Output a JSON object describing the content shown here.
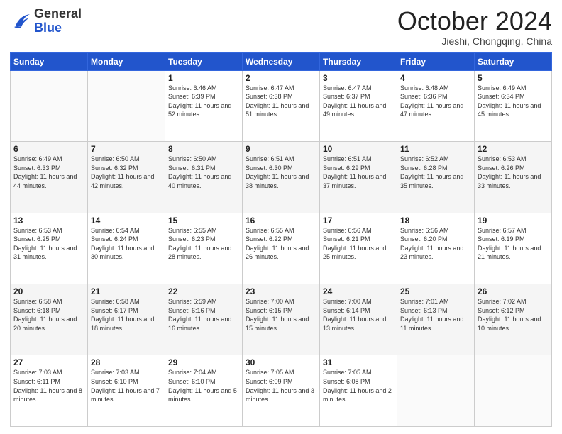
{
  "logo": {
    "general": "General",
    "blue": "Blue"
  },
  "header": {
    "month": "October 2024",
    "location": "Jieshi, Chongqing, China"
  },
  "days_of_week": [
    "Sunday",
    "Monday",
    "Tuesday",
    "Wednesday",
    "Thursday",
    "Friday",
    "Saturday"
  ],
  "weeks": [
    [
      {
        "day": "",
        "info": ""
      },
      {
        "day": "",
        "info": ""
      },
      {
        "day": "1",
        "info": "Sunrise: 6:46 AM\nSunset: 6:39 PM\nDaylight: 11 hours and 52 minutes."
      },
      {
        "day": "2",
        "info": "Sunrise: 6:47 AM\nSunset: 6:38 PM\nDaylight: 11 hours and 51 minutes."
      },
      {
        "day": "3",
        "info": "Sunrise: 6:47 AM\nSunset: 6:37 PM\nDaylight: 11 hours and 49 minutes."
      },
      {
        "day": "4",
        "info": "Sunrise: 6:48 AM\nSunset: 6:36 PM\nDaylight: 11 hours and 47 minutes."
      },
      {
        "day": "5",
        "info": "Sunrise: 6:49 AM\nSunset: 6:34 PM\nDaylight: 11 hours and 45 minutes."
      }
    ],
    [
      {
        "day": "6",
        "info": "Sunrise: 6:49 AM\nSunset: 6:33 PM\nDaylight: 11 hours and 44 minutes."
      },
      {
        "day": "7",
        "info": "Sunrise: 6:50 AM\nSunset: 6:32 PM\nDaylight: 11 hours and 42 minutes."
      },
      {
        "day": "8",
        "info": "Sunrise: 6:50 AM\nSunset: 6:31 PM\nDaylight: 11 hours and 40 minutes."
      },
      {
        "day": "9",
        "info": "Sunrise: 6:51 AM\nSunset: 6:30 PM\nDaylight: 11 hours and 38 minutes."
      },
      {
        "day": "10",
        "info": "Sunrise: 6:51 AM\nSunset: 6:29 PM\nDaylight: 11 hours and 37 minutes."
      },
      {
        "day": "11",
        "info": "Sunrise: 6:52 AM\nSunset: 6:28 PM\nDaylight: 11 hours and 35 minutes."
      },
      {
        "day": "12",
        "info": "Sunrise: 6:53 AM\nSunset: 6:26 PM\nDaylight: 11 hours and 33 minutes."
      }
    ],
    [
      {
        "day": "13",
        "info": "Sunrise: 6:53 AM\nSunset: 6:25 PM\nDaylight: 11 hours and 31 minutes."
      },
      {
        "day": "14",
        "info": "Sunrise: 6:54 AM\nSunset: 6:24 PM\nDaylight: 11 hours and 30 minutes."
      },
      {
        "day": "15",
        "info": "Sunrise: 6:55 AM\nSunset: 6:23 PM\nDaylight: 11 hours and 28 minutes."
      },
      {
        "day": "16",
        "info": "Sunrise: 6:55 AM\nSunset: 6:22 PM\nDaylight: 11 hours and 26 minutes."
      },
      {
        "day": "17",
        "info": "Sunrise: 6:56 AM\nSunset: 6:21 PM\nDaylight: 11 hours and 25 minutes."
      },
      {
        "day": "18",
        "info": "Sunrise: 6:56 AM\nSunset: 6:20 PM\nDaylight: 11 hours and 23 minutes."
      },
      {
        "day": "19",
        "info": "Sunrise: 6:57 AM\nSunset: 6:19 PM\nDaylight: 11 hours and 21 minutes."
      }
    ],
    [
      {
        "day": "20",
        "info": "Sunrise: 6:58 AM\nSunset: 6:18 PM\nDaylight: 11 hours and 20 minutes."
      },
      {
        "day": "21",
        "info": "Sunrise: 6:58 AM\nSunset: 6:17 PM\nDaylight: 11 hours and 18 minutes."
      },
      {
        "day": "22",
        "info": "Sunrise: 6:59 AM\nSunset: 6:16 PM\nDaylight: 11 hours and 16 minutes."
      },
      {
        "day": "23",
        "info": "Sunrise: 7:00 AM\nSunset: 6:15 PM\nDaylight: 11 hours and 15 minutes."
      },
      {
        "day": "24",
        "info": "Sunrise: 7:00 AM\nSunset: 6:14 PM\nDaylight: 11 hours and 13 minutes."
      },
      {
        "day": "25",
        "info": "Sunrise: 7:01 AM\nSunset: 6:13 PM\nDaylight: 11 hours and 11 minutes."
      },
      {
        "day": "26",
        "info": "Sunrise: 7:02 AM\nSunset: 6:12 PM\nDaylight: 11 hours and 10 minutes."
      }
    ],
    [
      {
        "day": "27",
        "info": "Sunrise: 7:03 AM\nSunset: 6:11 PM\nDaylight: 11 hours and 8 minutes."
      },
      {
        "day": "28",
        "info": "Sunrise: 7:03 AM\nSunset: 6:10 PM\nDaylight: 11 hours and 7 minutes."
      },
      {
        "day": "29",
        "info": "Sunrise: 7:04 AM\nSunset: 6:10 PM\nDaylight: 11 hours and 5 minutes."
      },
      {
        "day": "30",
        "info": "Sunrise: 7:05 AM\nSunset: 6:09 PM\nDaylight: 11 hours and 3 minutes."
      },
      {
        "day": "31",
        "info": "Sunrise: 7:05 AM\nSunset: 6:08 PM\nDaylight: 11 hours and 2 minutes."
      },
      {
        "day": "",
        "info": ""
      },
      {
        "day": "",
        "info": ""
      }
    ]
  ]
}
